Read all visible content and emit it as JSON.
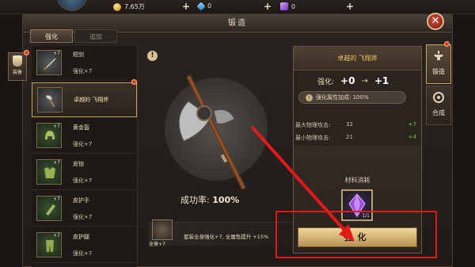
{
  "resources": [
    {
      "name": "gold",
      "value": "7.65万"
    },
    {
      "name": "diamond",
      "value": "0"
    },
    {
      "name": "crystal",
      "value": "0"
    }
  ],
  "title": "锻造",
  "close_label": "✕",
  "tabs": [
    {
      "label": "强化",
      "active": true
    },
    {
      "label": "追加",
      "active": false
    }
  ],
  "side_left": {
    "label": "装备"
  },
  "items": [
    {
      "name": "短剑",
      "plus": "+7",
      "level": "强化+7",
      "kind": "weapon"
    },
    {
      "name": "卓越的 飞翔斧",
      "plus": "",
      "level": "",
      "kind": "weapon",
      "selected": true
    },
    {
      "name": "黄金盔",
      "plus": "+7",
      "level": "强化+7",
      "kind": "armor"
    },
    {
      "name": "皮铠",
      "plus": "+7",
      "level": "强化+7",
      "kind": "armor"
    },
    {
      "name": "皮护手",
      "plus": "+7",
      "level": "强化+7",
      "kind": "armor"
    },
    {
      "name": "皮护腿",
      "plus": "+7",
      "level": "强化+7",
      "kind": "armor"
    }
  ],
  "center": {
    "info": "!",
    "success_label": "成功率:",
    "success_value": "100%",
    "bonus_sub": "全身+7",
    "bonus_text": "套装全身强化+7, 全属性提升 +15%"
  },
  "right_panel": {
    "title": "卓越的 飞翔斧",
    "upgrade_label": "强化:",
    "from": "+0",
    "to": "+1",
    "arrow": "→",
    "bonus_pill": "强化属性加成: 100%",
    "stats": [
      {
        "label": "最大物理攻击:",
        "value": "32",
        "add": "+7"
      },
      {
        "label": "最小物理攻击:",
        "value": "21",
        "add": "+4"
      }
    ],
    "material_title": "材料消耗",
    "material_count": "1/1",
    "button": "强化"
  },
  "vtabs": [
    {
      "label": "锻造",
      "active": true
    },
    {
      "label": "合成",
      "active": false
    }
  ],
  "colors": {
    "accent": "#f3c26a",
    "positive": "#72c83c",
    "alert": "#e41818"
  }
}
